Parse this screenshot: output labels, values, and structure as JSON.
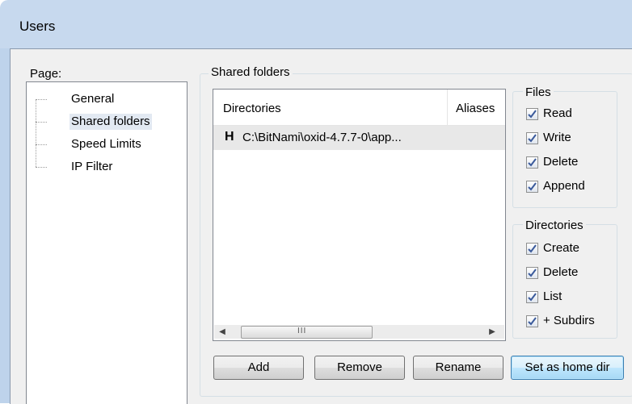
{
  "window": {
    "title": "Users"
  },
  "page_label": "Page:",
  "tree": {
    "items": [
      {
        "label": "General"
      },
      {
        "label": "Shared folders",
        "selected": true
      },
      {
        "label": "Speed Limits"
      },
      {
        "label": "IP Filter"
      }
    ]
  },
  "shared_folders": {
    "group_label": "Shared folders",
    "columns": [
      "Directories",
      "Aliases"
    ],
    "rows": [
      {
        "home_marker": "H",
        "path": "C:\\BitNami\\oxid-4.7.7-0\\app...",
        "alias": ""
      }
    ],
    "scrollbar": {
      "left_arrow": "◀",
      "right_arrow": "▶",
      "grip": "III"
    }
  },
  "files": {
    "group_label": "Files",
    "options": [
      {
        "label": "Read",
        "checked": true
      },
      {
        "label": "Write",
        "checked": true
      },
      {
        "label": "Delete",
        "checked": true
      },
      {
        "label": "Append",
        "checked": true
      }
    ]
  },
  "directories": {
    "group_label": "Directories",
    "options": [
      {
        "label": "Create",
        "checked": true
      },
      {
        "label": "Delete",
        "checked": true
      },
      {
        "label": "List",
        "checked": true
      },
      {
        "label": "+ Subdirs",
        "checked": true
      }
    ]
  },
  "buttons": {
    "add": "Add",
    "remove": "Remove",
    "rename": "Rename",
    "set_home": "Set as home dir"
  },
  "colors": {
    "titlebar": "#c7d9ee",
    "dialog_bg": "#f0f0f0",
    "selected_row": "#e8e8e8",
    "checkmark": "#3a5a9b"
  },
  "icons": {
    "checkbox_check": "checkmark-icon",
    "scroll_left": "arrow-left-icon",
    "scroll_right": "arrow-right-icon"
  }
}
